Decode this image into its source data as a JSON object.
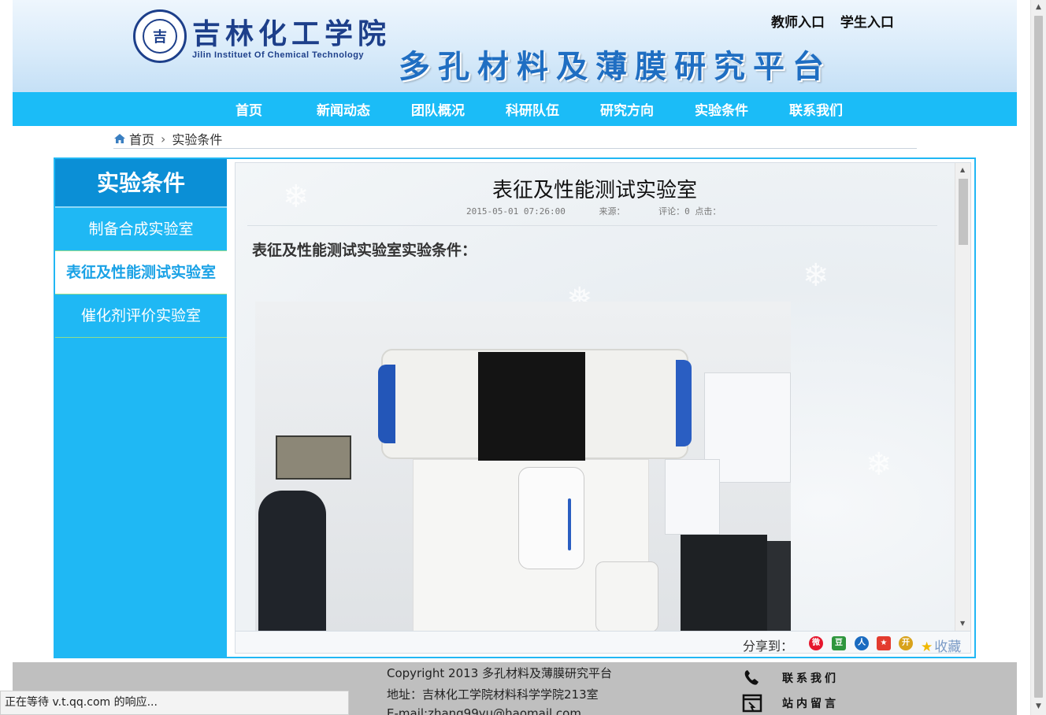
{
  "header": {
    "logo_cn": "吉林化工学院",
    "logo_en": "Jilin Instituet Of Chemical Technology",
    "site_title": "多孔材料及薄膜研究平台",
    "teacher_link": "教师入口",
    "student_link": "学生入口"
  },
  "nav": {
    "items": [
      {
        "label": "首页"
      },
      {
        "label": "新闻动态"
      },
      {
        "label": "团队概况"
      },
      {
        "label": "科研队伍"
      },
      {
        "label": "研究方向"
      },
      {
        "label": "实验条件"
      },
      {
        "label": "联系我们"
      }
    ]
  },
  "breadcrumb": {
    "home": "首页",
    "current": "实验条件"
  },
  "sidebar": {
    "title": "实验条件",
    "items": [
      {
        "label": "制备合成实验室",
        "active": false
      },
      {
        "label": "表征及性能测试实验室",
        "active": true
      },
      {
        "label": "催化剂评价实验室",
        "active": false
      }
    ]
  },
  "article": {
    "title": "表征及性能测试实验室",
    "date": "2015-05-01 07:26:00",
    "source_label": "来源：",
    "comments_label": "评论：0 点击：",
    "subheading": "表征及性能测试实验室实验条件："
  },
  "share": {
    "label": "分享到：",
    "favorite": "收藏",
    "icons": [
      "weibo-icon",
      "douban-icon",
      "renren-icon",
      "qzone-icon",
      "kaixin-icon"
    ]
  },
  "footer": {
    "copyright": "Copyright  2013 多孔材料及薄膜研究平台",
    "address": "地址：吉林化工学院材料科学学院213室",
    "email": "E-mail:zhang99yu@haomail.com",
    "contact": "联系我们",
    "message": "站内留言"
  },
  "status_bar": {
    "text": "正在等待 v.t.qq.com 的响应..."
  },
  "colors": {
    "nav_bg": "#1bbcf7",
    "sidebar_bg": "#1fb8f4",
    "sidebar_title_bg": "#0b8fd6",
    "title_blue": "#1f6ec2",
    "footer_bg": "#bfbfbf"
  }
}
